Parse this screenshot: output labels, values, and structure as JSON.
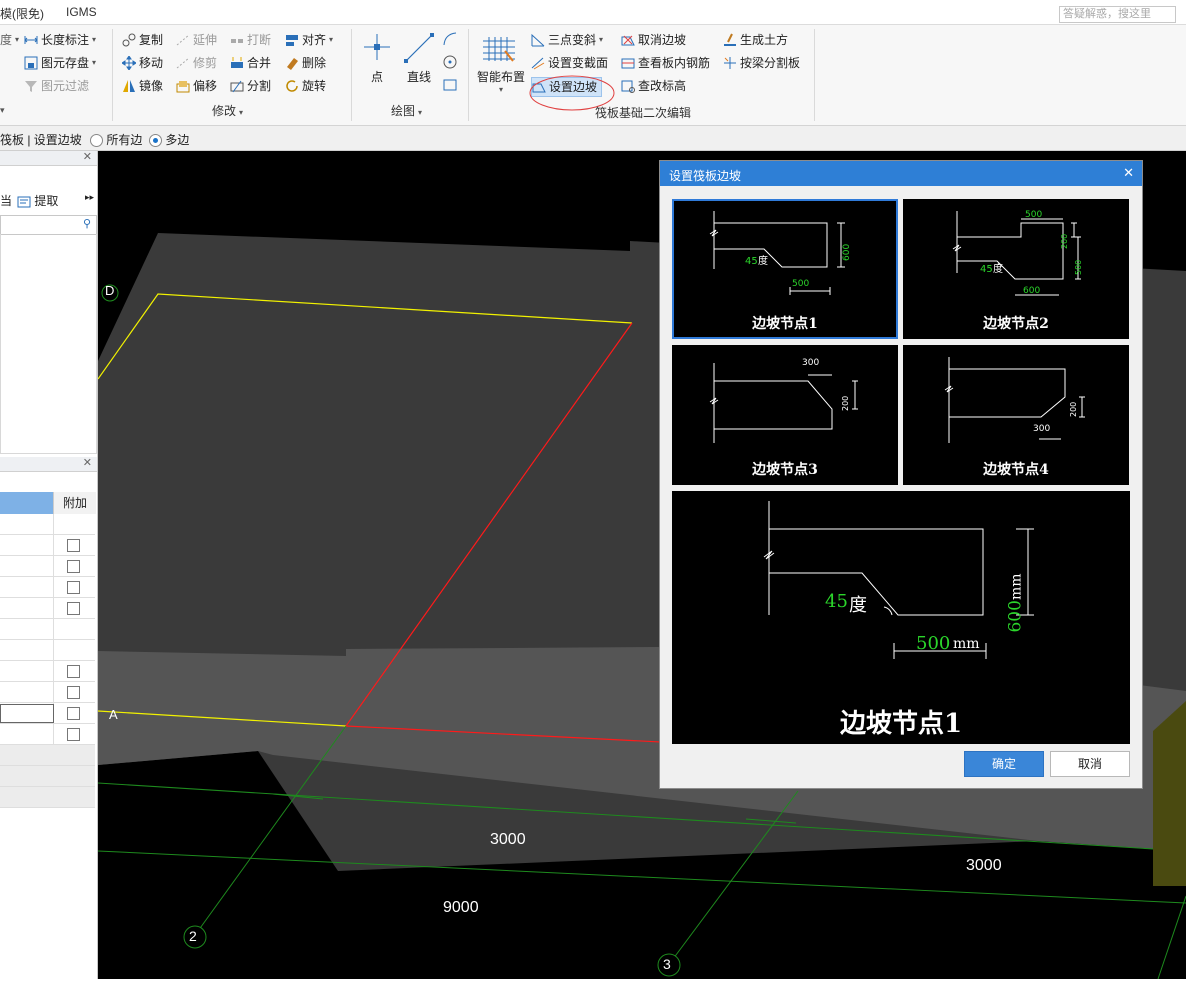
{
  "titlebar": {
    "left_fragment": "模(限免)",
    "app_name": "IGMS",
    "search_placeholder": "答疑解惑，搜这里"
  },
  "ribbon": {
    "col1": {
      "a": "长度标注",
      "b": "图元存盘",
      "c": "图元过滤"
    },
    "modify": {
      "copy": "复制",
      "extend": "延伸",
      "break": "打断",
      "align": "对齐",
      "move": "移动",
      "trim": "修剪",
      "merge": "合并",
      "delete": "删除",
      "mirror": "镜像",
      "offset": "偏移",
      "split": "分割",
      "rotate": "旋转",
      "group_label": "修改"
    },
    "draw": {
      "point": "点",
      "line": "直线",
      "group_label": "绘图"
    },
    "smart_layout": "智能布置",
    "edit": {
      "three_point_slope": "三点变斜",
      "set_section": "设置变截面",
      "set_edge_slope": "设置边坡",
      "cancel_slope": "取消边坡",
      "view_rebar": "查看板内钢筋",
      "change_elev": "查改标高",
      "gen_earthwork": "生成土方",
      "split_by_beam": "按梁分割板",
      "group_label": "筏板基础二次编辑"
    }
  },
  "optbar": {
    "breadcrumb": "筏板 | 设置边坡",
    "opt_all": "所有边",
    "opt_multi": "多边"
  },
  "leftpanel": {
    "toolbar_a": "当",
    "toolbar_b": "提取",
    "col_header": "附加"
  },
  "canvas": {
    "axis_labels": [
      "D",
      "A"
    ],
    "dims": [
      "3000",
      "3000",
      "9000"
    ],
    "grid_numbers": [
      "2",
      "3"
    ]
  },
  "dialog": {
    "title": "设置筏板边坡",
    "tiles": [
      {
        "caption": "边坡节点1",
        "dims": [
          "600",
          "500",
          "45",
          "度"
        ]
      },
      {
        "caption": "边坡节点2",
        "dims": [
          "500",
          "200",
          "500",
          "45",
          "度",
          "600"
        ]
      },
      {
        "caption": "边坡节点3",
        "dims": [
          "300",
          "200"
        ]
      },
      {
        "caption": "边坡节点4",
        "dims": [
          "200",
          "300"
        ]
      }
    ],
    "preview": {
      "caption": "边坡节点1",
      "angle": "45",
      "angle_unit": "度",
      "height": "600",
      "width": "500",
      "unit": "mm"
    },
    "ok": "确定",
    "cancel": "取消"
  },
  "colors": {
    "accent": "#2e7fd6",
    "ok_button": "#3a86d8",
    "grid_green": "#1e8a1e",
    "dim_green": "#2bd62b",
    "edge_red": "#ff1a1a",
    "edge_yellow": "#f2f200"
  }
}
